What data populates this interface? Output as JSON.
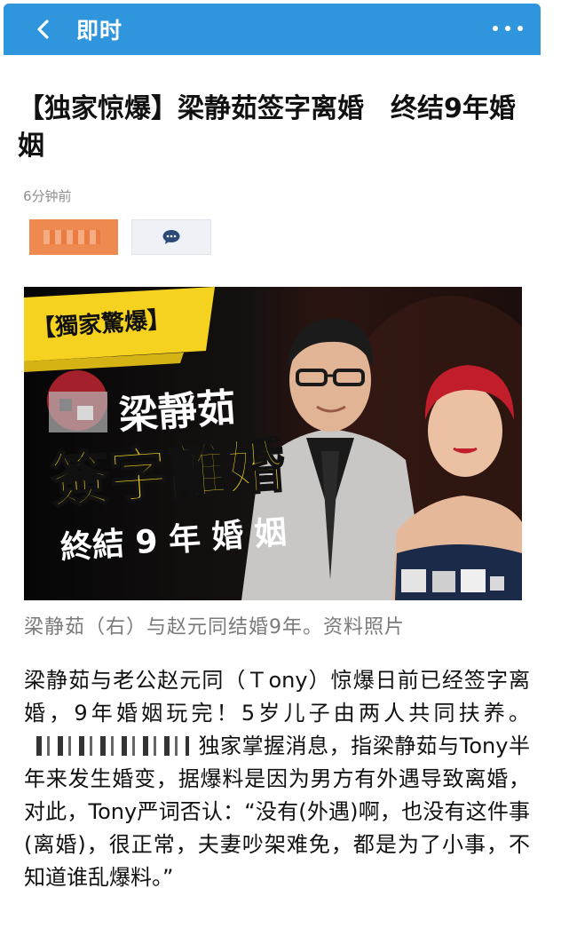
{
  "navbar": {
    "title": "即时"
  },
  "article": {
    "headline": "【独家惊爆】梁静茹签字离婚　终结9年婚姻",
    "timestamp": "6分钟前",
    "caption": "梁静茹（右）与赵元同结婚9年。资料照片",
    "body": {
      "part1": "梁静茹与老公赵元同（Ｔony）惊爆日前已经签字离婚，9年婚姻玩完！5岁儿子由两人共同扶养。",
      "part2": "独家掌握消息，指梁静茹与Tony半年来发生婚变，据爆料是因为男方有外遇导致离婚，对此，Tony严词否认：“没有(外遇)啊，也没有这件事(离婚)，很正常，夫妻吵架难免，都是为了小事，不知道谁乱爆料。”"
    }
  },
  "photo": {
    "banner": "【獨家驚爆】",
    "name": "梁靜茹",
    "headline": "簽字離婚",
    "subline": "終結 9 年 婚 姻"
  },
  "colors": {
    "navbar": "#2f95dc",
    "source_tag": "#ee8a4f",
    "banner_yellow": "#f5d21f"
  },
  "icons": {
    "back": "chevron-left-icon",
    "more": "more-dots-icon",
    "comment": "comment-bubble-icon"
  }
}
